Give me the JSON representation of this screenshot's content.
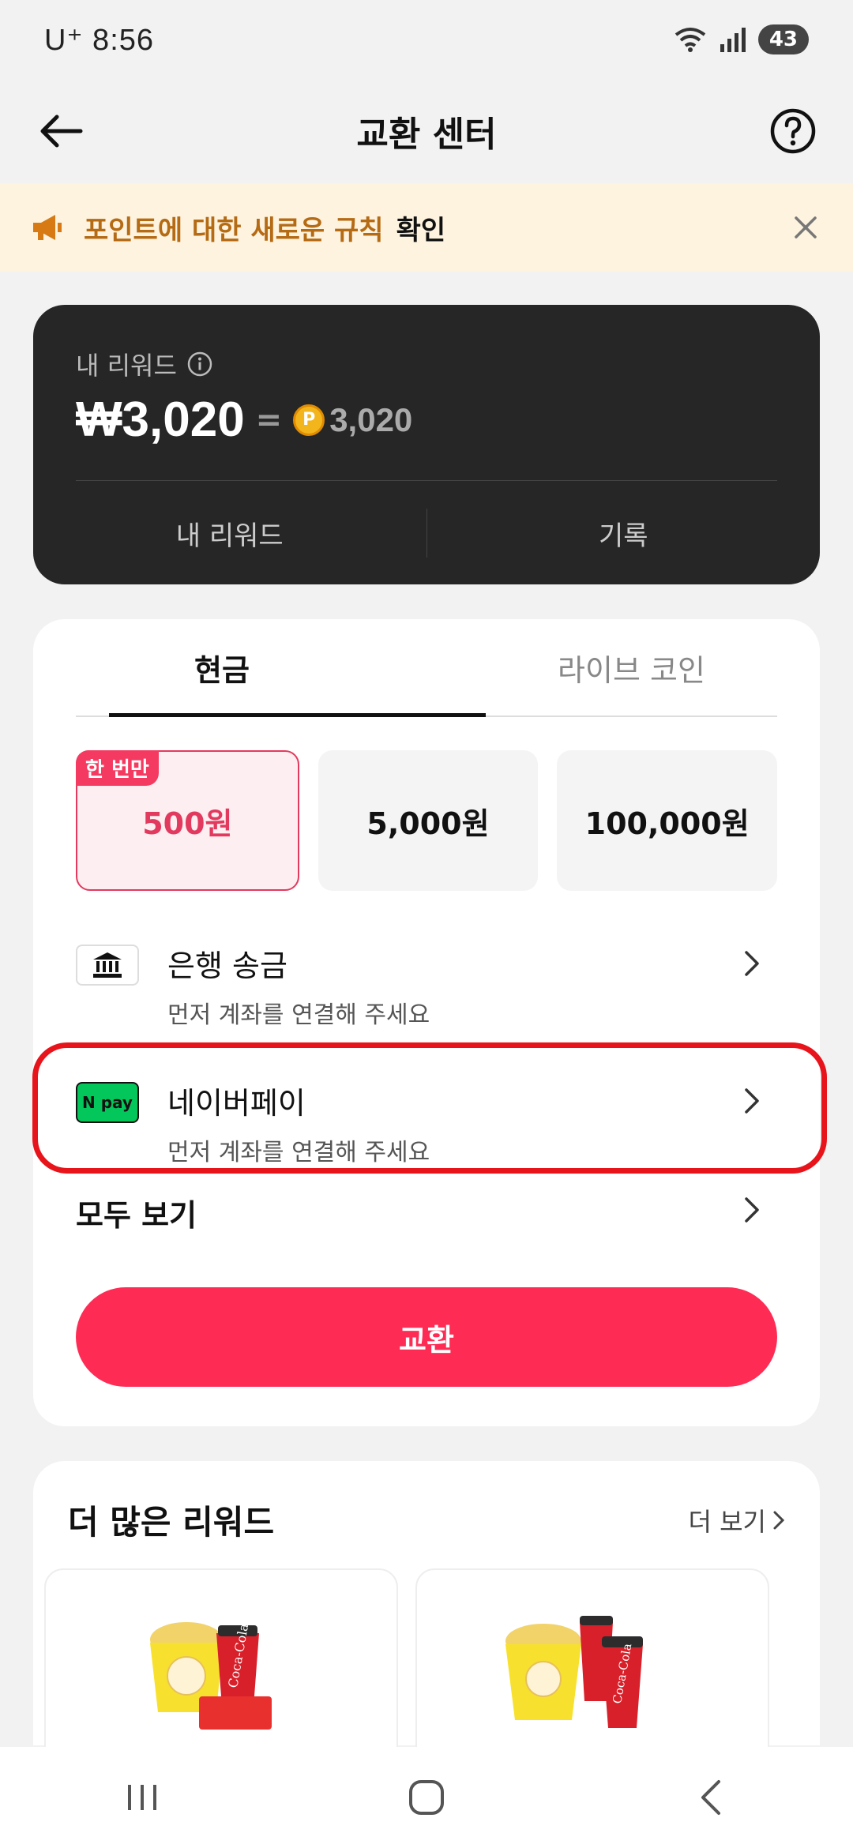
{
  "status_bar": {
    "carrier_time": "U⁺ 8:56",
    "battery": "43"
  },
  "header": {
    "title": "교환 센터"
  },
  "notice": {
    "text": "포인트에 대한 새로운 규칙",
    "link": "확인"
  },
  "reward": {
    "label": "내 리워드",
    "amount_krw": "₩3,020",
    "equals": "=",
    "coin_symbol": "P",
    "points": "3,020",
    "tabs": [
      "내 리워드",
      "기록"
    ]
  },
  "exchange": {
    "tabs": [
      "현금",
      "라이브 코인"
    ],
    "amount_badge": "한 번만",
    "amounts": [
      "500원",
      "5,000원",
      "100,000원"
    ],
    "methods": [
      {
        "title": "은행 송금",
        "sub": "먼저 계좌를 연결해 주세요"
      },
      {
        "title": "네이버페이",
        "sub": "먼저 계좌를 연결해 주세요",
        "icon_text": "N pay"
      }
    ],
    "see_all": "모두 보기",
    "button": "교환"
  },
  "more": {
    "title": "더 많은 리워드",
    "link": "더 보기"
  },
  "colors": {
    "accent": "#fe2c55",
    "highlight": "#e8141b",
    "notice_bg": "#fdf3df"
  }
}
